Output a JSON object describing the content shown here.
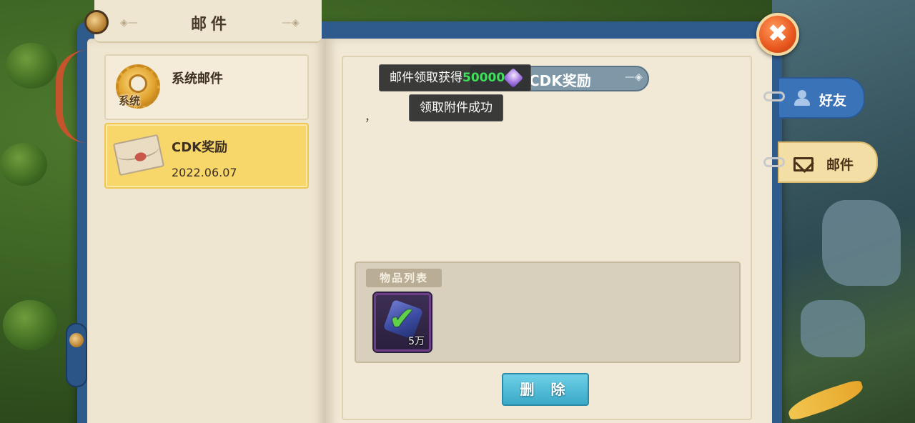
{
  "window": {
    "title": "邮件",
    "close_icon": "✖"
  },
  "mail_list": [
    {
      "name": "系统邮件",
      "date": "",
      "icon": "gear-icon",
      "icon_label": "系统",
      "selected": false
    },
    {
      "name": "CDK奖励",
      "date": "2022.06.07",
      "icon": "envelope-icon",
      "selected": true
    }
  ],
  "mail_detail": {
    "title": "CDK奖励",
    "body": "，",
    "items_label": "物品列表",
    "items": [
      {
        "icon": "gem-icon",
        "count": "5万",
        "claimed": true
      }
    ],
    "delete_label": "删 除"
  },
  "toasts": {
    "claim_prefix": "邮件领取获得",
    "claim_amount": "50000",
    "claim_icon": "gem-icon",
    "success": "领取附件成功"
  },
  "side_tabs": [
    {
      "label": "好友",
      "icon": "person-icon",
      "active": false
    },
    {
      "label": "邮件",
      "icon": "envelope-icon",
      "active": true
    }
  ],
  "colors": {
    "accent_blue": "#2f5a8c",
    "selected_yellow": "#f7d76a",
    "button_cyan": "#3aa9c8",
    "close_orange": "#e8561e",
    "amount_green": "#3ee05a"
  }
}
